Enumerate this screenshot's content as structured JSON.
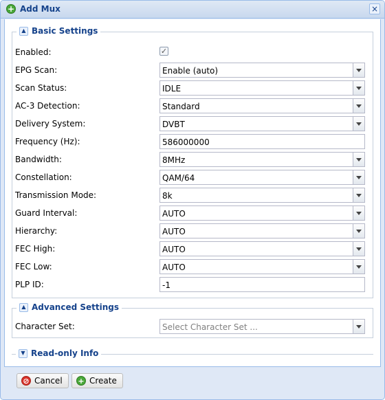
{
  "window": {
    "title": "Add Mux",
    "title_icon": "add-icon",
    "close_glyph": "×"
  },
  "basic": {
    "legend": "Basic Settings",
    "enabled": {
      "label": "Enabled:",
      "checked": true,
      "check_glyph": "✓"
    },
    "fields": [
      {
        "label": "EPG Scan:",
        "value": "Enable (auto)",
        "type": "combo"
      },
      {
        "label": "Scan Status:",
        "value": "IDLE",
        "type": "combo"
      },
      {
        "label": "AC-3 Detection:",
        "value": "Standard",
        "type": "combo"
      },
      {
        "label": "Delivery System:",
        "value": "DVBT",
        "type": "combo"
      },
      {
        "label": "Frequency (Hz):",
        "value": "586000000",
        "type": "text"
      },
      {
        "label": "Bandwidth:",
        "value": "8MHz",
        "type": "combo"
      },
      {
        "label": "Constellation:",
        "value": "QAM/64",
        "type": "combo"
      },
      {
        "label": "Transmission Mode:",
        "value": "8k",
        "type": "combo"
      },
      {
        "label": "Guard Interval:",
        "value": "AUTO",
        "type": "combo"
      },
      {
        "label": "Hierarchy:",
        "value": "AUTO",
        "type": "combo"
      },
      {
        "label": "FEC High:",
        "value": "AUTO",
        "type": "combo"
      },
      {
        "label": "FEC Low:",
        "value": "AUTO",
        "type": "combo"
      },
      {
        "label": "PLP ID:",
        "value": "-1",
        "type": "text"
      }
    ]
  },
  "advanced": {
    "legend": "Advanced Settings",
    "character_set": {
      "label": "Character Set:",
      "placeholder": "Select Character Set ..."
    }
  },
  "readonly": {
    "legend": "Read-only Info"
  },
  "buttons": {
    "cancel": "Cancel",
    "create": "Create"
  },
  "colors": {
    "title_text": "#15428b",
    "border": "#99bbe8",
    "create_icon": "#4aa83a",
    "cancel_icon": "#d9342b"
  }
}
